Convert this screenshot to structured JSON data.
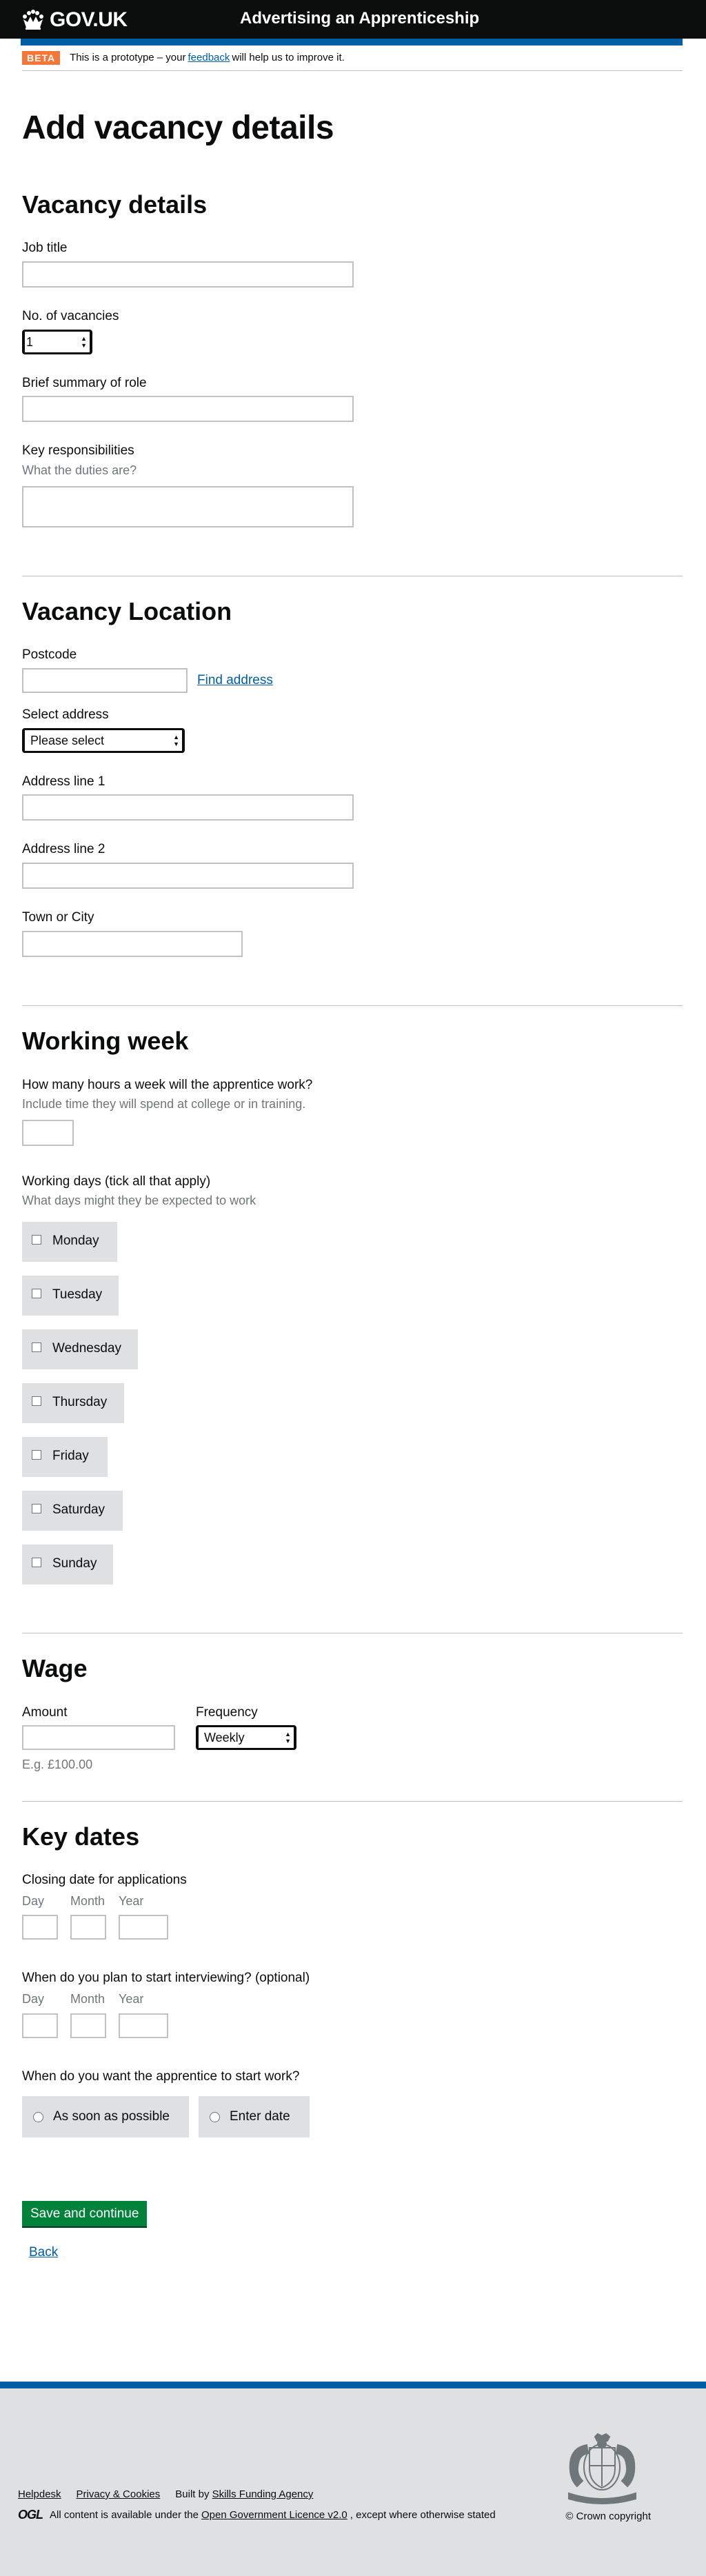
{
  "header": {
    "brand": "GOV.UK",
    "service_name": "Advertising an Apprenticeship"
  },
  "phase_banner": {
    "tag": "BETA",
    "text_before": "This is a prototype – your",
    "link": "feedback",
    "text_after": "will help us to improve it."
  },
  "page_title": "Add vacancy details",
  "vacancy_details": {
    "heading": "Vacancy details",
    "job_title_label": "Job title",
    "job_title_value": "",
    "vacancies_label": "No. of vacancies",
    "vacancies_value": "1",
    "summary_label": "Brief summary of role",
    "summary_value": "",
    "responsibilities_label": "Key responsibilities",
    "responsibilities_hint": "What the duties are?"
  },
  "location": {
    "heading": "Vacancy Location",
    "postcode_label": "Postcode",
    "find_address": "Find address",
    "select_label": "Select address",
    "select_value": "Please select",
    "address1_label": "Address line 1",
    "address2_label": "Address line 2",
    "town_label": "Town or City"
  },
  "working_week": {
    "heading": "Working week",
    "hours_label": "How many hours a week will the apprentice work?",
    "hours_hint": "Include time they will spend at college or in training.",
    "days_label": "Working days (tick all that apply)",
    "days_hint": "What days might they be expected to work",
    "days": [
      "Monday",
      "Tuesday",
      "Wednesday",
      "Thursday",
      "Friday",
      "Saturday",
      "Sunday"
    ]
  },
  "wage": {
    "heading": "Wage",
    "amount_label": "Amount",
    "amount_hint": "E.g. £100.00",
    "frequency_label": "Frequency",
    "frequency_value": "Weekly"
  },
  "key_dates": {
    "heading": "Key dates",
    "closing_label": "Closing date for applications",
    "interview_label": "When do you plan to start interviewing? (optional)",
    "day": "Day",
    "month": "Month",
    "year": "Year",
    "start_label": "When do you want the apprentice to start work?",
    "start_options": [
      "As soon as possible",
      "Enter date"
    ]
  },
  "actions": {
    "save": "Save and continue",
    "back": "Back"
  },
  "footer": {
    "links": [
      "Helpdesk",
      "Privacy & Cookies"
    ],
    "built_by_prefix": "Built by",
    "built_by_link": "Skills Funding Agency",
    "ogl_logo": "OGL",
    "licence_before": "All content is available under the",
    "licence_link": "Open Government Licence v2.0",
    "licence_after": ", except where otherwise stated",
    "copyright": "© Crown copyright"
  },
  "colors": {
    "header_bg": "#0b0c0c",
    "accent_blue": "#005ea5",
    "beta_tag": "#f47738",
    "button_green": "#00823b",
    "panel_grey": "#dee0e2"
  }
}
